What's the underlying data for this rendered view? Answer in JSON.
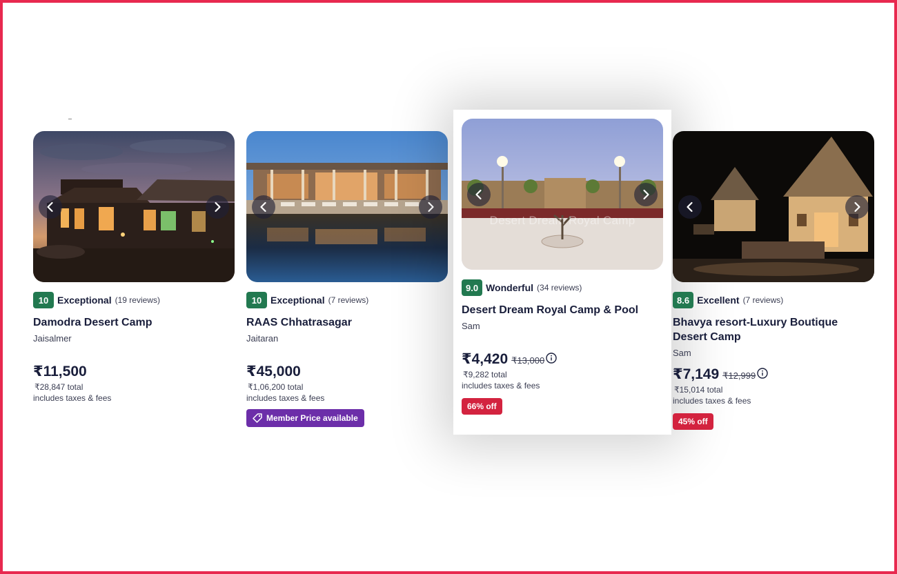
{
  "hotels": [
    {
      "score": "10",
      "rating_label": "Exceptional",
      "reviews": "(19 reviews)",
      "name": "Damodra Desert Camp",
      "location": "Jaisalmer",
      "price": "₹11,500",
      "total": "₹28,847 total",
      "fees": "includes taxes & fees"
    },
    {
      "score": "10",
      "rating_label": "Exceptional",
      "reviews": "(7 reviews)",
      "name": "RAAS Chhatrasagar",
      "location": "Jaitaran",
      "price": "₹45,000",
      "total": "₹1,06,200 total",
      "fees": "includes taxes & fees",
      "member_badge": "Member Price available"
    },
    {
      "score": "9.0",
      "rating_label": "Wonderful",
      "reviews": "(34 reviews)",
      "name": "Desert Dream Royal Camp & Pool",
      "location": "Sam",
      "price": "₹4,420",
      "original_price": "₹13,000",
      "total": "₹9,282 total",
      "fees": "includes taxes & fees",
      "discount": "66% off",
      "photo_watermark": "Desert Dream Royal Camp"
    },
    {
      "score": "8.6",
      "rating_label": "Excellent",
      "reviews": "(7 reviews)",
      "name": "Bhavya resort-Luxury Boutique Desert Camp",
      "location": "Sam",
      "price": "₹7,149",
      "original_price": "₹12,999",
      "total": "₹15,014 total",
      "fees": "includes taxes & fees",
      "discount": "45% off"
    }
  ],
  "icons": {
    "prev": "chevron-left-icon",
    "next": "chevron-right-icon",
    "info": "info-icon",
    "tag": "tag-icon"
  },
  "colors": {
    "rating_badge": "#227950",
    "discount_badge": "#d3233f",
    "member_badge": "#6c2ea9",
    "frame": "#e8294f"
  }
}
